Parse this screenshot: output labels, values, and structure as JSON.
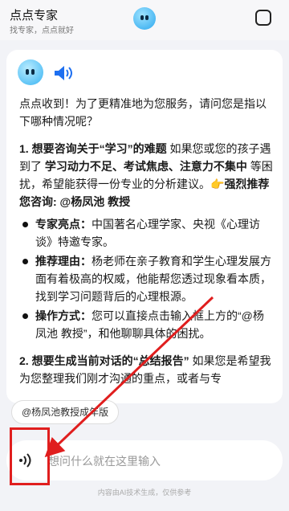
{
  "header": {
    "title": "点点专家",
    "subtitle": "找专家，点点就好"
  },
  "message": {
    "intro": "点点收到！为了更精准地为您服务，请问您是指以下哪种情况呢？",
    "section1": {
      "prefix": "1. 想要咨询关于“学习”的难题",
      "text_a": " 如果您或您的孩子遇到了 ",
      "highlight": "学习动力不足、考试焦虑、注意力不集中",
      "text_b": " 等困扰，希望能获得一份专业的分析建议。",
      "emoji": "👉",
      "recommend": "强烈推荐您咨询: @杨凤池 教授"
    },
    "bullets": [
      {
        "label": "专家亮点：",
        "text": "中国著名心理学家、央视《心理访谈》特邀专家。"
      },
      {
        "label": "推荐理由：",
        "text": "杨老师在亲子教育和学生心理发展方面有着极高的权威，他能帮您透过现象看本质，找到学习问题背后的心理根源。"
      },
      {
        "label": "操作方式：",
        "text": "您可以直接点击输入框上方的“@杨凤池 教授”，和他聊聊具体的困扰。"
      }
    ],
    "section2": {
      "prefix": "2. 想要生成当前对话的“总结报告”",
      "text": " 如果您是希望我为您整理我们刚才沟通的重点，或者与专"
    }
  },
  "chip": {
    "label": "@杨凤池教授成年版"
  },
  "input": {
    "placeholder": "想问什么就在这里输入"
  },
  "footer": {
    "note": "内容由AI技术生成，仅供参考"
  },
  "colors": {
    "annotation_red": "#e01e1e",
    "mascot_blue": "#38b3f2",
    "speaker_blue": "#1e6ff0"
  }
}
